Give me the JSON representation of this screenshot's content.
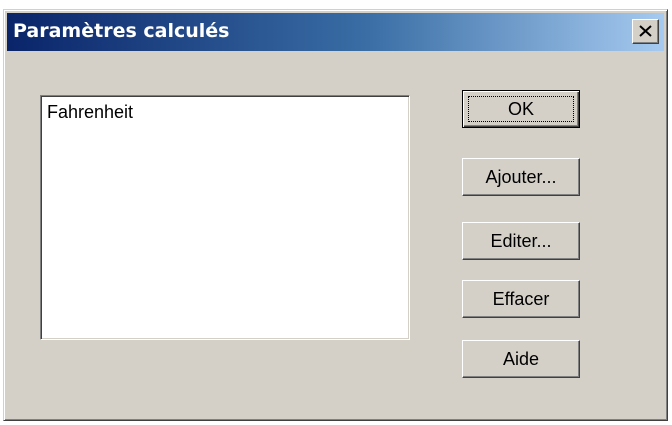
{
  "window": {
    "title": "Paramètres calculés",
    "close_icon": "close-icon"
  },
  "list": {
    "items": [
      "Fahrenheit"
    ]
  },
  "buttons": {
    "ok": "OK",
    "add": "Ajouter...",
    "edit": "Editer...",
    "delete": "Effacer",
    "help": "Aide"
  },
  "colors": {
    "titlebar_start": "#0a246a",
    "titlebar_end": "#a6caf0",
    "face": "#d4d0c8"
  }
}
